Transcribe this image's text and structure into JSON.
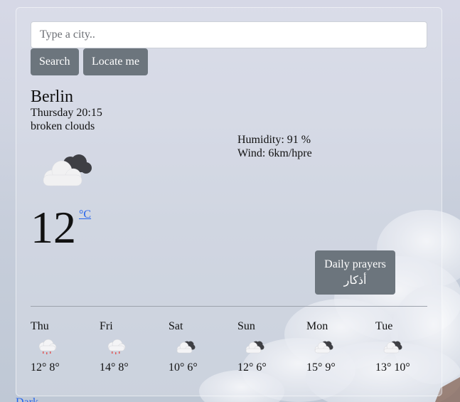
{
  "search": {
    "placeholder": "Type a city..",
    "value": ""
  },
  "buttons": {
    "search": "Search",
    "locate": "Locate me"
  },
  "current": {
    "city": "Berlin",
    "datetime": "Thursday 20:15",
    "description": "broken clouds",
    "icon": "broken-clouds-icon",
    "temperature": "12",
    "unit": "°C",
    "humidity": "Humidity: 91 %",
    "wind": "Wind: 6km/hpre"
  },
  "prayers_button": {
    "line1": "Daily prayers",
    "line2": "أذكار"
  },
  "forecast": [
    {
      "day": "Thu",
      "icon": "rain-cloud-icon",
      "temps": "12° 8°"
    },
    {
      "day": "Fri",
      "icon": "rain-cloud-icon",
      "temps": "14° 8°"
    },
    {
      "day": "Sat",
      "icon": "broken-clouds-icon",
      "temps": "10° 6°"
    },
    {
      "day": "Sun",
      "icon": "broken-clouds-icon",
      "temps": "12° 6°"
    },
    {
      "day": "Mon",
      "icon": "broken-clouds-icon",
      "temps": "15° 9°"
    },
    {
      "day": "Tue",
      "icon": "broken-clouds-icon",
      "temps": "13° 10°"
    }
  ],
  "footer": {
    "link": "Dark"
  },
  "colors": {
    "button_bg": "#6c757d",
    "link": "#2563eb",
    "background": "#cfd4e1"
  }
}
